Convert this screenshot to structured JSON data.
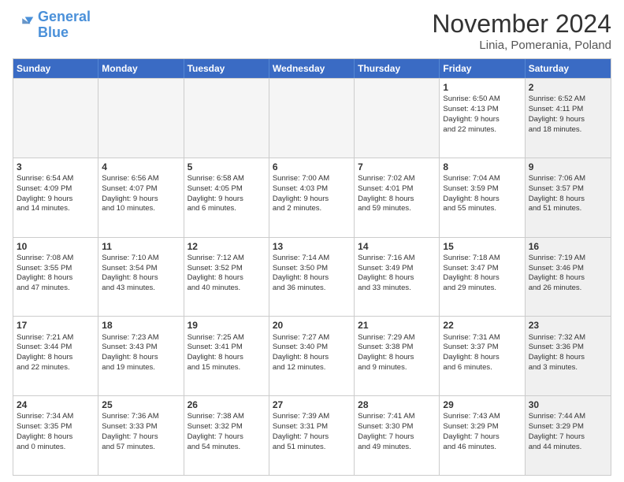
{
  "header": {
    "logo_line1": "General",
    "logo_line2": "Blue",
    "month": "November 2024",
    "location": "Linia, Pomerania, Poland"
  },
  "weekdays": [
    "Sunday",
    "Monday",
    "Tuesday",
    "Wednesday",
    "Thursday",
    "Friday",
    "Saturday"
  ],
  "rows": [
    [
      {
        "day": "",
        "text": "",
        "empty": true
      },
      {
        "day": "",
        "text": "",
        "empty": true
      },
      {
        "day": "",
        "text": "",
        "empty": true
      },
      {
        "day": "",
        "text": "",
        "empty": true
      },
      {
        "day": "",
        "text": "",
        "empty": true
      },
      {
        "day": "1",
        "text": "Sunrise: 6:50 AM\nSunset: 4:13 PM\nDaylight: 9 hours\nand 22 minutes.",
        "empty": false,
        "shaded": false
      },
      {
        "day": "2",
        "text": "Sunrise: 6:52 AM\nSunset: 4:11 PM\nDaylight: 9 hours\nand 18 minutes.",
        "empty": false,
        "shaded": true
      }
    ],
    [
      {
        "day": "3",
        "text": "Sunrise: 6:54 AM\nSunset: 4:09 PM\nDaylight: 9 hours\nand 14 minutes.",
        "empty": false,
        "shaded": false
      },
      {
        "day": "4",
        "text": "Sunrise: 6:56 AM\nSunset: 4:07 PM\nDaylight: 9 hours\nand 10 minutes.",
        "empty": false,
        "shaded": false
      },
      {
        "day": "5",
        "text": "Sunrise: 6:58 AM\nSunset: 4:05 PM\nDaylight: 9 hours\nand 6 minutes.",
        "empty": false,
        "shaded": false
      },
      {
        "day": "6",
        "text": "Sunrise: 7:00 AM\nSunset: 4:03 PM\nDaylight: 9 hours\nand 2 minutes.",
        "empty": false,
        "shaded": false
      },
      {
        "day": "7",
        "text": "Sunrise: 7:02 AM\nSunset: 4:01 PM\nDaylight: 8 hours\nand 59 minutes.",
        "empty": false,
        "shaded": false
      },
      {
        "day": "8",
        "text": "Sunrise: 7:04 AM\nSunset: 3:59 PM\nDaylight: 8 hours\nand 55 minutes.",
        "empty": false,
        "shaded": false
      },
      {
        "day": "9",
        "text": "Sunrise: 7:06 AM\nSunset: 3:57 PM\nDaylight: 8 hours\nand 51 minutes.",
        "empty": false,
        "shaded": true
      }
    ],
    [
      {
        "day": "10",
        "text": "Sunrise: 7:08 AM\nSunset: 3:55 PM\nDaylight: 8 hours\nand 47 minutes.",
        "empty": false,
        "shaded": false
      },
      {
        "day": "11",
        "text": "Sunrise: 7:10 AM\nSunset: 3:54 PM\nDaylight: 8 hours\nand 43 minutes.",
        "empty": false,
        "shaded": false
      },
      {
        "day": "12",
        "text": "Sunrise: 7:12 AM\nSunset: 3:52 PM\nDaylight: 8 hours\nand 40 minutes.",
        "empty": false,
        "shaded": false
      },
      {
        "day": "13",
        "text": "Sunrise: 7:14 AM\nSunset: 3:50 PM\nDaylight: 8 hours\nand 36 minutes.",
        "empty": false,
        "shaded": false
      },
      {
        "day": "14",
        "text": "Sunrise: 7:16 AM\nSunset: 3:49 PM\nDaylight: 8 hours\nand 33 minutes.",
        "empty": false,
        "shaded": false
      },
      {
        "day": "15",
        "text": "Sunrise: 7:18 AM\nSunset: 3:47 PM\nDaylight: 8 hours\nand 29 minutes.",
        "empty": false,
        "shaded": false
      },
      {
        "day": "16",
        "text": "Sunrise: 7:19 AM\nSunset: 3:46 PM\nDaylight: 8 hours\nand 26 minutes.",
        "empty": false,
        "shaded": true
      }
    ],
    [
      {
        "day": "17",
        "text": "Sunrise: 7:21 AM\nSunset: 3:44 PM\nDaylight: 8 hours\nand 22 minutes.",
        "empty": false,
        "shaded": false
      },
      {
        "day": "18",
        "text": "Sunrise: 7:23 AM\nSunset: 3:43 PM\nDaylight: 8 hours\nand 19 minutes.",
        "empty": false,
        "shaded": false
      },
      {
        "day": "19",
        "text": "Sunrise: 7:25 AM\nSunset: 3:41 PM\nDaylight: 8 hours\nand 15 minutes.",
        "empty": false,
        "shaded": false
      },
      {
        "day": "20",
        "text": "Sunrise: 7:27 AM\nSunset: 3:40 PM\nDaylight: 8 hours\nand 12 minutes.",
        "empty": false,
        "shaded": false
      },
      {
        "day": "21",
        "text": "Sunrise: 7:29 AM\nSunset: 3:38 PM\nDaylight: 8 hours\nand 9 minutes.",
        "empty": false,
        "shaded": false
      },
      {
        "day": "22",
        "text": "Sunrise: 7:31 AM\nSunset: 3:37 PM\nDaylight: 8 hours\nand 6 minutes.",
        "empty": false,
        "shaded": false
      },
      {
        "day": "23",
        "text": "Sunrise: 7:32 AM\nSunset: 3:36 PM\nDaylight: 8 hours\nand 3 minutes.",
        "empty": false,
        "shaded": true
      }
    ],
    [
      {
        "day": "24",
        "text": "Sunrise: 7:34 AM\nSunset: 3:35 PM\nDaylight: 8 hours\nand 0 minutes.",
        "empty": false,
        "shaded": false
      },
      {
        "day": "25",
        "text": "Sunrise: 7:36 AM\nSunset: 3:33 PM\nDaylight: 7 hours\nand 57 minutes.",
        "empty": false,
        "shaded": false
      },
      {
        "day": "26",
        "text": "Sunrise: 7:38 AM\nSunset: 3:32 PM\nDaylight: 7 hours\nand 54 minutes.",
        "empty": false,
        "shaded": false
      },
      {
        "day": "27",
        "text": "Sunrise: 7:39 AM\nSunset: 3:31 PM\nDaylight: 7 hours\nand 51 minutes.",
        "empty": false,
        "shaded": false
      },
      {
        "day": "28",
        "text": "Sunrise: 7:41 AM\nSunset: 3:30 PM\nDaylight: 7 hours\nand 49 minutes.",
        "empty": false,
        "shaded": false
      },
      {
        "day": "29",
        "text": "Sunrise: 7:43 AM\nSunset: 3:29 PM\nDaylight: 7 hours\nand 46 minutes.",
        "empty": false,
        "shaded": false
      },
      {
        "day": "30",
        "text": "Sunrise: 7:44 AM\nSunset: 3:29 PM\nDaylight: 7 hours\nand 44 minutes.",
        "empty": false,
        "shaded": true
      }
    ]
  ]
}
